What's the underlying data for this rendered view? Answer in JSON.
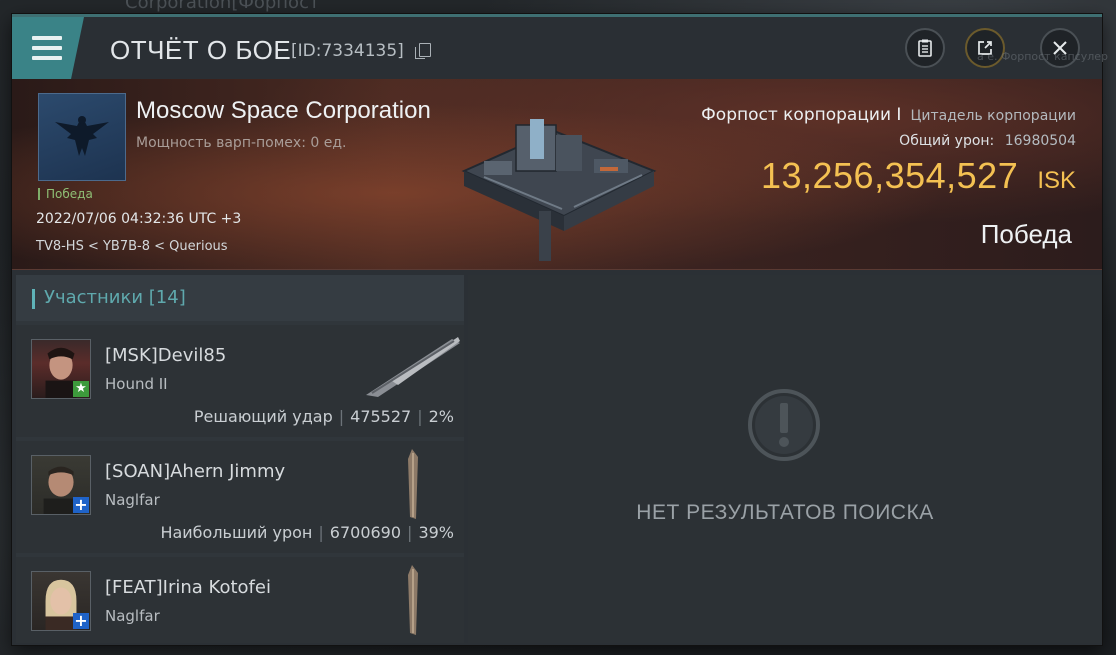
{
  "background": {
    "top_text": "Corporation[Форпост",
    "right_text": "а е. Форпост капсулер"
  },
  "window": {
    "title": "ОТЧЁТ О БОЕ",
    "report_id": "[ID:7334135]"
  },
  "banner": {
    "corp_name": "Moscow Space Corporation",
    "warp_disruption": "Мощность варп-помех: 0 ед.",
    "result_small": "Победа",
    "datetime": "2022/07/06 04:32:36 UTC +3",
    "route": "TV8-HS < YB7B-8 < Querious",
    "target_name": "Форпост корпорации I",
    "target_type": "Цитадель корпорации",
    "total_damage_label": "Общий урон:",
    "total_damage_value": "16980504",
    "isk_value": "13,256,354,527",
    "isk_unit": "ISK",
    "result_big": "Победа"
  },
  "participants": {
    "header": "Участники [14]",
    "items": [
      {
        "pilot": "[MSK]Devil85",
        "ship": "Hound II",
        "role": "Решающий удар",
        "damage": "475527",
        "percent": "2%",
        "badge": "star"
      },
      {
        "pilot": "[SOAN]Ahern Jimmy",
        "ship": "Naglfar",
        "role": "Наибольший урон",
        "damage": "6700690",
        "percent": "39%",
        "badge": "plus"
      },
      {
        "pilot": "[FEAT]Irina Kotofei",
        "ship": "Naglfar",
        "role": "",
        "damage": "",
        "percent": "",
        "badge": "plus"
      }
    ]
  },
  "results": {
    "empty_text": "НЕТ РЕЗУЛЬТАТОВ ПОИСКА"
  },
  "colors": {
    "accent": "#3a8387",
    "isk": "#f4c152",
    "victory": "#8fbf75"
  },
  "icons": [
    "menu-icon",
    "copy-icon",
    "notes-icon",
    "share-icon",
    "close-icon",
    "exclamation-icon"
  ]
}
